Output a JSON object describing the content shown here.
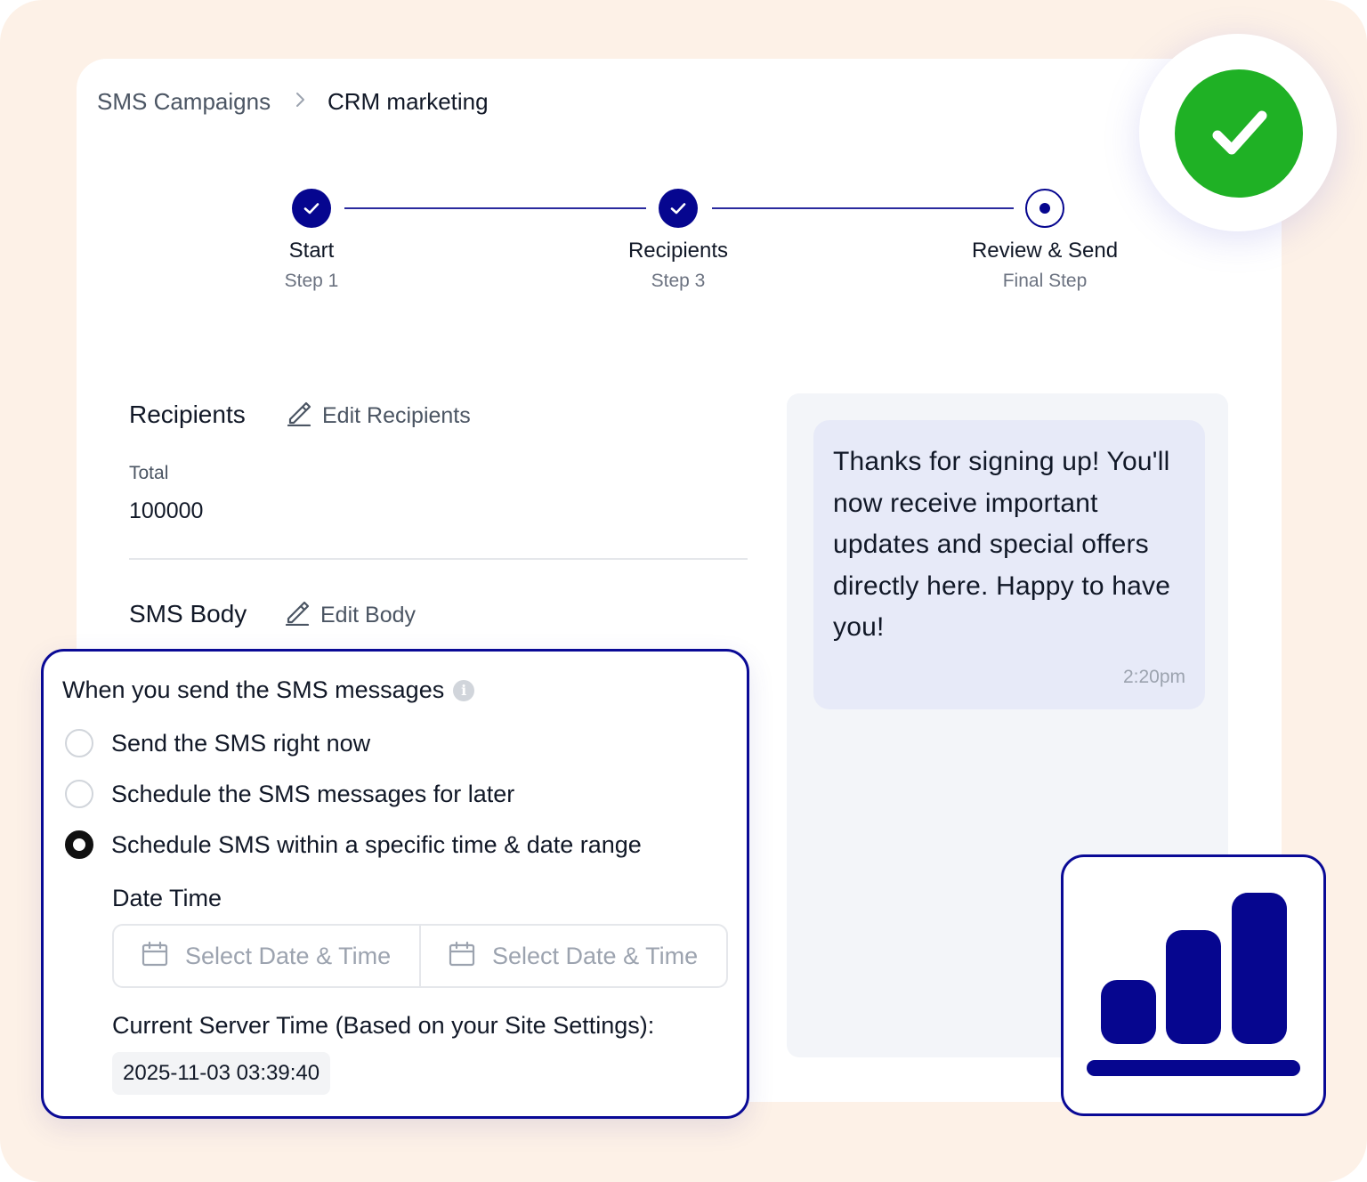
{
  "breadcrumb": {
    "root": "SMS Campaigns",
    "current": "CRM marketing"
  },
  "stepper": {
    "steps": [
      {
        "title": "Start",
        "subtitle": "Step 1",
        "status": "completed"
      },
      {
        "title": "Recipients",
        "subtitle": "Step 3",
        "status": "completed"
      },
      {
        "title": "Review & Send",
        "subtitle": "Final Step",
        "status": "current"
      }
    ]
  },
  "recipients": {
    "title": "Recipients",
    "edit_label": "Edit Recipients",
    "total_label": "Total",
    "total_value": "100000"
  },
  "sms_body": {
    "title": "SMS Body",
    "edit_label": "Edit Body"
  },
  "preview": {
    "message": "Thanks for signing up! You'll now receive important updates and special offers directly here. Happy to have you!",
    "time": "2:20pm"
  },
  "schedule": {
    "title": "When you send the SMS messages",
    "options": [
      {
        "label": "Send the SMS right now",
        "selected": false
      },
      {
        "label": "Schedule the SMS messages for later",
        "selected": false
      },
      {
        "label": "Schedule SMS within a specific time & date range",
        "selected": true
      }
    ],
    "date_time_label": "Date Time",
    "start_placeholder": "Select Date & Time",
    "end_placeholder": "Select Date & Time",
    "server_time_label": "Current Server Time (Based on your Site Settings):",
    "server_time_value": "2025-11-03 03:39:40"
  },
  "icons": {
    "success": "check-circle-icon",
    "stats": "bar-chart-icon",
    "edit": "pencil-icon",
    "calendar": "calendar-icon",
    "info": "info-icon",
    "breadcrumb_separator": "chevron-right-icon"
  },
  "colors": {
    "primary": "#06068f",
    "success": "#1fb125",
    "background": "#fdf1e7",
    "bubble": "#e7eaf8"
  }
}
